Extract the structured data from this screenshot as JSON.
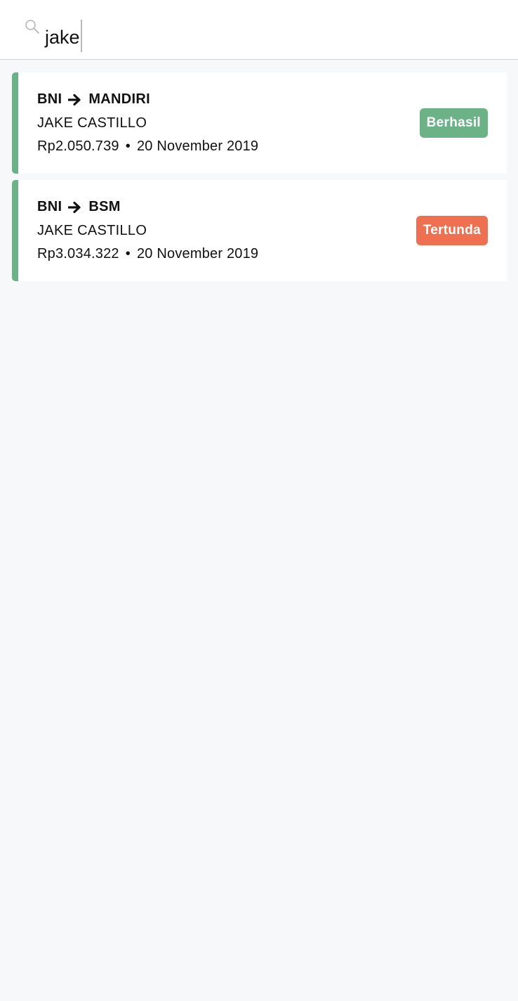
{
  "search": {
    "icon": "search-icon",
    "value": "jake"
  },
  "transactions": [
    {
      "from": "BNI",
      "to": "MANDIRI",
      "name": "JAKE CASTILLO",
      "amount": "Rp2.050.739",
      "date": "20 November 2019",
      "status": "Berhasil",
      "status_color": "#6bb386"
    },
    {
      "from": "BNI",
      "to": "BSM",
      "name": "JAKE CASTILLO",
      "amount": "Rp3.034.322",
      "date": "20 November 2019",
      "status": "Tertunda",
      "status_color": "#ef7050"
    }
  ],
  "colors": {
    "accent": "#6bb386",
    "pending": "#ef7050",
    "background": "#f6f8fa"
  }
}
